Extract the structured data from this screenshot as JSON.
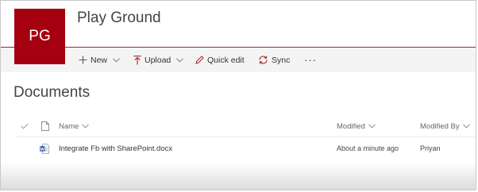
{
  "site": {
    "logo_text": "PG",
    "title": "Play Ground",
    "brand_color": "#a4000f"
  },
  "command_bar": {
    "new_label": "New",
    "upload_label": "Upload",
    "quick_edit_label": "Quick edit",
    "sync_label": "Sync",
    "more_label": "···",
    "icons": [
      "plus-icon",
      "upload-arrow-icon",
      "pencil-icon",
      "sync-icon",
      "ellipsis-icon"
    ]
  },
  "library": {
    "title": "Documents",
    "columns": {
      "name": "Name",
      "modified": "Modified",
      "modified_by": "Modified By"
    },
    "rows": [
      {
        "name": "Integrate Fb with SharePoint.docx",
        "modified": "About a minute ago",
        "modified_by": "Priyan",
        "icon": "word-doc-icon"
      }
    ]
  }
}
